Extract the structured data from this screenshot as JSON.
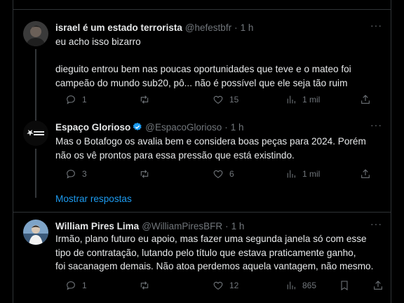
{
  "tweets": [
    {
      "name": "israel é um estado terrorista",
      "handle": "@hefestbfr",
      "time": "1 h",
      "more": "···",
      "text1": "eu acho isso bizarro",
      "text2": "dieguito entrou bem nas poucas oportunidades que teve e o mateo foi",
      "text3": "campeão do mundo sub20, pô... não é possível que ele seja tão ruim",
      "replies": "1",
      "retweets": "",
      "likes": "15",
      "views": "1 mil"
    },
    {
      "name": "Espaço Glorioso",
      "handle": "@EspacoGlorioso",
      "time": "1 h",
      "more": "···",
      "avatar_text": "ESPAÇO GLORIOSO",
      "text1": "Mas o Botafogo os avalia bem e considera boas peças para 2024. Porém",
      "text2": "não os vê prontos para essa pressão que está existindo.",
      "replies": "3",
      "retweets": "",
      "likes": "6",
      "views": "1 mil"
    },
    {
      "name": "William Pires Lima",
      "handle": "@WilliamPiresBFR",
      "time": "1 h",
      "more": "···",
      "text1": "Irmão, plano futuro eu apoio, mas fazer uma segunda janela só com esse",
      "text2": "tipo de contratação, lutando pelo título que estava praticamente ganho,",
      "text3": "foi sacanagem demais. Não atoa perdemos aquela vantagem, não mesmo.",
      "replies": "1",
      "retweets": "",
      "likes": "12",
      "views": "865"
    }
  ],
  "show_replies": "Mostrar respostas",
  "colors": {
    "bg": "#000000",
    "text": "#e7e9ea",
    "muted": "#71767b",
    "accent": "#1d9bf0",
    "border": "#2f3336"
  }
}
